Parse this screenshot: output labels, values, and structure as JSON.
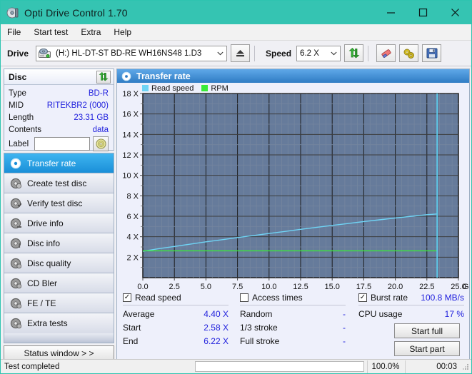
{
  "window": {
    "title": "Opti Drive Control 1.70",
    "icon": "disc-icon",
    "minimize": "—",
    "maximize": "☐",
    "close": "✕",
    "titlebar_color": "#35c4b2"
  },
  "menu": {
    "items": [
      {
        "label": "File",
        "name": "menu-file"
      },
      {
        "label": "Start test",
        "name": "menu-start-test"
      },
      {
        "label": "Extra",
        "name": "menu-extra"
      },
      {
        "label": "Help",
        "name": "menu-help"
      }
    ]
  },
  "toolbar": {
    "drive_label": "Drive",
    "drive_value": "(H:)  HL-DT-ST BD-RE  WH16NS48 1.D3",
    "speed_label": "Speed",
    "speed_value": "6.2 X",
    "dropdown_arrow": "⌄",
    "eject_icon": "eject-icon",
    "refresh_icon": "refresh-icon",
    "erase_icon": "eraser-icon",
    "tools_icon": "tools-icon",
    "save_icon": "save-icon"
  },
  "disc": {
    "title": "Disc",
    "refresh_icon": "refresh-icon",
    "rows": [
      {
        "key": "Type",
        "value": "BD-R"
      },
      {
        "key": "MID",
        "value": "RITEKBR2 (000)"
      },
      {
        "key": "Length",
        "value": "23.31 GB"
      },
      {
        "key": "Contents",
        "value": "data"
      }
    ],
    "label_key": "Label",
    "label_value": "",
    "label_placeholder": "",
    "disc_button_icon": "cd-disc-icon"
  },
  "nav": {
    "items": [
      {
        "label": "Transfer rate",
        "name": "sidebar-item-transfer-rate",
        "icon": "disc-icon",
        "active": true
      },
      {
        "label": "Create test disc",
        "name": "sidebar-item-create-test-disc",
        "icon": "disc-icon",
        "active": false
      },
      {
        "label": "Verify test disc",
        "name": "sidebar-item-verify-test-disc",
        "icon": "disc-icon",
        "active": false
      },
      {
        "label": "Drive info",
        "name": "sidebar-item-drive-info",
        "icon": "disc-icon",
        "active": false
      },
      {
        "label": "Disc info",
        "name": "sidebar-item-disc-info",
        "icon": "disc-icon",
        "active": false
      },
      {
        "label": "Disc quality",
        "name": "sidebar-item-disc-quality",
        "icon": "disc-icon",
        "active": false
      },
      {
        "label": "CD Bler",
        "name": "sidebar-item-cd-bler",
        "icon": "disc-icon",
        "active": false
      },
      {
        "label": "FE / TE",
        "name": "sidebar-item-fe-te",
        "icon": "disc-icon",
        "active": false
      },
      {
        "label": "Extra tests",
        "name": "sidebar-item-extra-tests",
        "icon": "disc-icon",
        "active": false
      }
    ],
    "status_window": "Status window > >"
  },
  "panel": {
    "title": "Transfer rate",
    "icon": "disc-icon"
  },
  "chart_data": {
    "type": "line",
    "title": "Transfer rate",
    "xlabel": "GB",
    "ylabel": "X",
    "xlim": [
      0.0,
      25.0
    ],
    "ylim": [
      0,
      18
    ],
    "xticks": [
      0.0,
      2.5,
      5.0,
      7.5,
      10.0,
      12.5,
      15.0,
      17.5,
      20.0,
      22.5,
      25.0
    ],
    "xticklabels": [
      "0.0",
      "2.5",
      "5.0",
      "7.5",
      "10.0",
      "12.5",
      "15.0",
      "17.5",
      "20.0",
      "22.5",
      "25.0"
    ],
    "x_unit_label": "GB",
    "yticks": [
      2,
      4,
      6,
      8,
      10,
      12,
      14,
      16,
      18
    ],
    "yticklabels": [
      "2 X",
      "4 X",
      "6 X",
      "8 X",
      "10 X",
      "12 X",
      "14 X",
      "16 X",
      "18 X"
    ],
    "grid": true,
    "legend_position": "top-left",
    "plot_bg": "#667b9b",
    "series": [
      {
        "name": "Read speed",
        "color": "#6fd4f5",
        "x": [
          0.0,
          1.2,
          2.5,
          3.8,
          5.0,
          6.3,
          7.5,
          8.8,
          10.0,
          11.3,
          12.5,
          13.8,
          15.0,
          16.3,
          17.5,
          18.8,
          20.0,
          21.3,
          22.5,
          23.31
        ],
        "values": [
          2.58,
          2.82,
          3.05,
          3.28,
          3.5,
          3.71,
          3.92,
          4.12,
          4.32,
          4.52,
          4.72,
          4.92,
          5.11,
          5.3,
          5.48,
          5.66,
          5.83,
          6.0,
          6.15,
          6.22
        ]
      },
      {
        "name": "RPM",
        "color": "#39ea39",
        "x": [
          0.0,
          5.0,
          10.0,
          15.0,
          20.0,
          23.31
        ],
        "values": [
          2.62,
          2.62,
          2.62,
          2.62,
          2.62,
          2.62
        ]
      }
    ],
    "end_marker": {
      "x": 23.31,
      "color": "#5bd2f0",
      "label": "end-of-data"
    }
  },
  "stats": {
    "read_speed": {
      "checkbox_label": "Read speed",
      "checked": true,
      "check_glyph": "✓",
      "rows": [
        {
          "key": "Average",
          "value": "4.40 X"
        },
        {
          "key": "Start",
          "value": "2.58 X"
        },
        {
          "key": "End",
          "value": "6.22 X"
        }
      ]
    },
    "access_times": {
      "checkbox_label": "Access times",
      "checked": false,
      "check_glyph": "",
      "rows": [
        {
          "key": "Random",
          "value": "-"
        },
        {
          "key": "1/3 stroke",
          "value": "-"
        },
        {
          "key": "Full stroke",
          "value": "-"
        }
      ]
    },
    "burst_rate": {
      "checkbox_label": "Burst rate",
      "checked": true,
      "check_glyph": "✓",
      "value": "100.8 MB/s",
      "cpu_key": "CPU usage",
      "cpu_value": "17 %"
    },
    "buttons": [
      {
        "label": "Start full",
        "name": "start-full-button"
      },
      {
        "label": "Start part",
        "name": "start-part-button"
      }
    ]
  },
  "statusbar": {
    "message": "Test completed",
    "progress_percent": 100.0,
    "progress_text": "100.0%",
    "elapsed": "00:03",
    "progress_color": "#08a81f"
  }
}
